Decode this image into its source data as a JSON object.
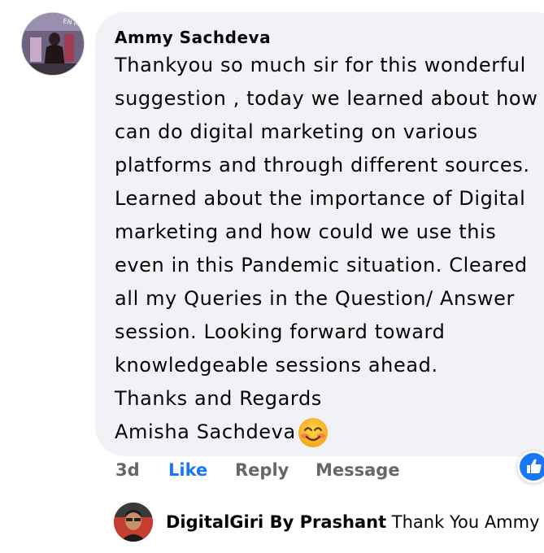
{
  "comment": {
    "author": "Ammy Sachdeva",
    "lines": [
      "Thankyou so much sir for this wonderful",
      "suggestion , today we learned about how",
      "can do digital marketing on various",
      "platforms and through different sources.",
      "Learned about the importance of Digital",
      "marketing and how could we use this",
      "even in this Pandemic situation. Cleared",
      "all my Queries in the Question/ Answer",
      "session. Looking forward toward",
      "knowledgeable sessions ahead.",
      "Thanks and Regards",
      "Amisha Sachdeva"
    ],
    "emoji": "smiling-face-emoji",
    "timestamp": "3d",
    "like_label": "Like",
    "reply_label": "Reply",
    "message_label": "Message",
    "reaction": "like-reaction-icon"
  },
  "reply": {
    "author": "DigitalGiri By Prashant",
    "text": "Thank You Ammy S··"
  },
  "colors": {
    "bubble": "#f0f2f5",
    "like_blue": "#1877f2",
    "meta_gray": "#65676b",
    "text": "#050505"
  }
}
